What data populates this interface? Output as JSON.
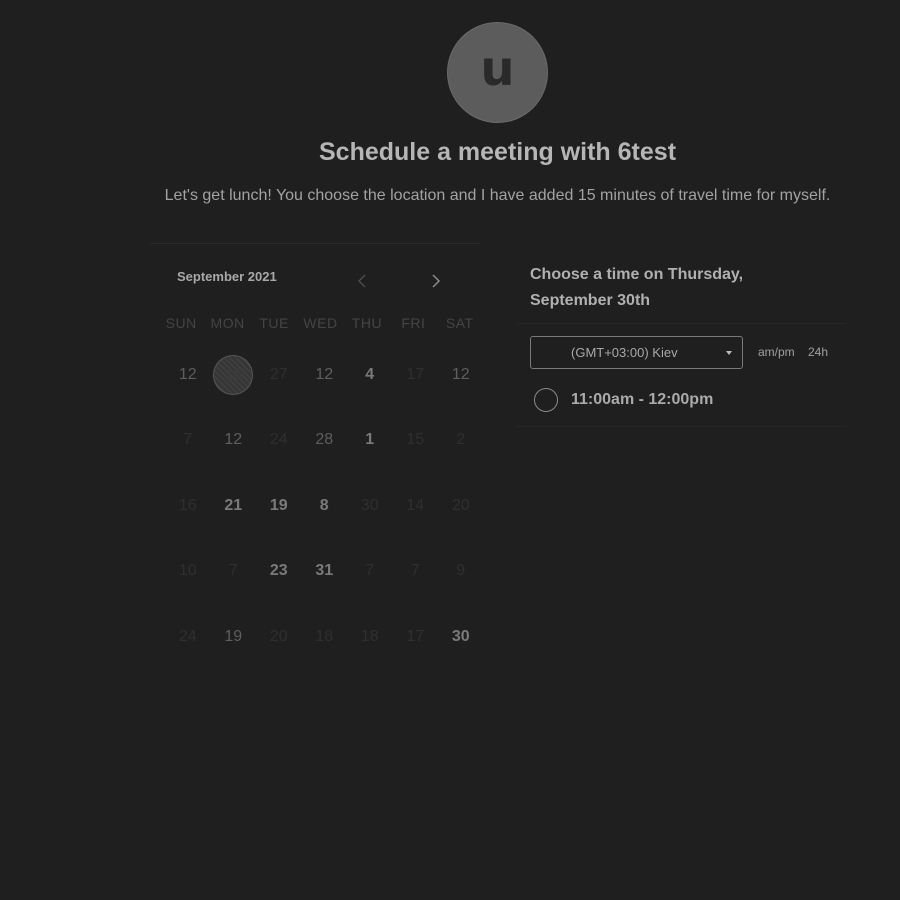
{
  "host": {
    "avatar_letter": "u",
    "title": "Schedule a meeting with 6test",
    "description": "Let's get lunch! You choose the location and I have added 15 minutes of travel time for myself."
  },
  "calendar": {
    "month_label": "September 2021",
    "weekdays": [
      "SUN",
      "MON",
      "TUE",
      "WED",
      "THU",
      "FRI",
      "SAT"
    ],
    "weeks": [
      [
        {
          "d": "12",
          "s": "mid"
        },
        {
          "d": "15",
          "s": "selected"
        },
        {
          "d": "27",
          "s": "dim"
        },
        {
          "d": "12",
          "s": "mid"
        },
        {
          "d": "4",
          "s": "bright"
        },
        {
          "d": "17",
          "s": "dim"
        },
        {
          "d": "12",
          "s": "mid"
        }
      ],
      [
        {
          "d": "7",
          "s": "dim"
        },
        {
          "d": "12",
          "s": "mid"
        },
        {
          "d": "24",
          "s": "dim"
        },
        {
          "d": "28",
          "s": "mid"
        },
        {
          "d": "1",
          "s": "bright"
        },
        {
          "d": "15",
          "s": "dim"
        },
        {
          "d": "2",
          "s": "dim"
        }
      ],
      [
        {
          "d": "16",
          "s": "dim"
        },
        {
          "d": "21",
          "s": "bright"
        },
        {
          "d": "19",
          "s": "bright"
        },
        {
          "d": "8",
          "s": "bright"
        },
        {
          "d": "30",
          "s": "dim"
        },
        {
          "d": "14",
          "s": "dim"
        },
        {
          "d": "20",
          "s": "dim"
        }
      ],
      [
        {
          "d": "10",
          "s": "dim"
        },
        {
          "d": "7",
          "s": "dim"
        },
        {
          "d": "23",
          "s": "bright"
        },
        {
          "d": "31",
          "s": "bright"
        },
        {
          "d": "7",
          "s": "dim"
        },
        {
          "d": "7",
          "s": "dim"
        },
        {
          "d": "9",
          "s": "dim"
        }
      ],
      [
        {
          "d": "24",
          "s": "dim"
        },
        {
          "d": "19",
          "s": "mid"
        },
        {
          "d": "20",
          "s": "dim"
        },
        {
          "d": "18",
          "s": "dim"
        },
        {
          "d": "18",
          "s": "dim"
        },
        {
          "d": "17",
          "s": "dim"
        },
        {
          "d": "30",
          "s": "bright"
        }
      ]
    ]
  },
  "times": {
    "heading_line1": "Choose a time on Thursday,",
    "heading_line2": "September 30th",
    "timezone": "(GMT+03:00) Kiev",
    "format_ampm": "am/pm",
    "format_24h": "24h",
    "slots": [
      "11:00am - 12:00pm"
    ]
  }
}
